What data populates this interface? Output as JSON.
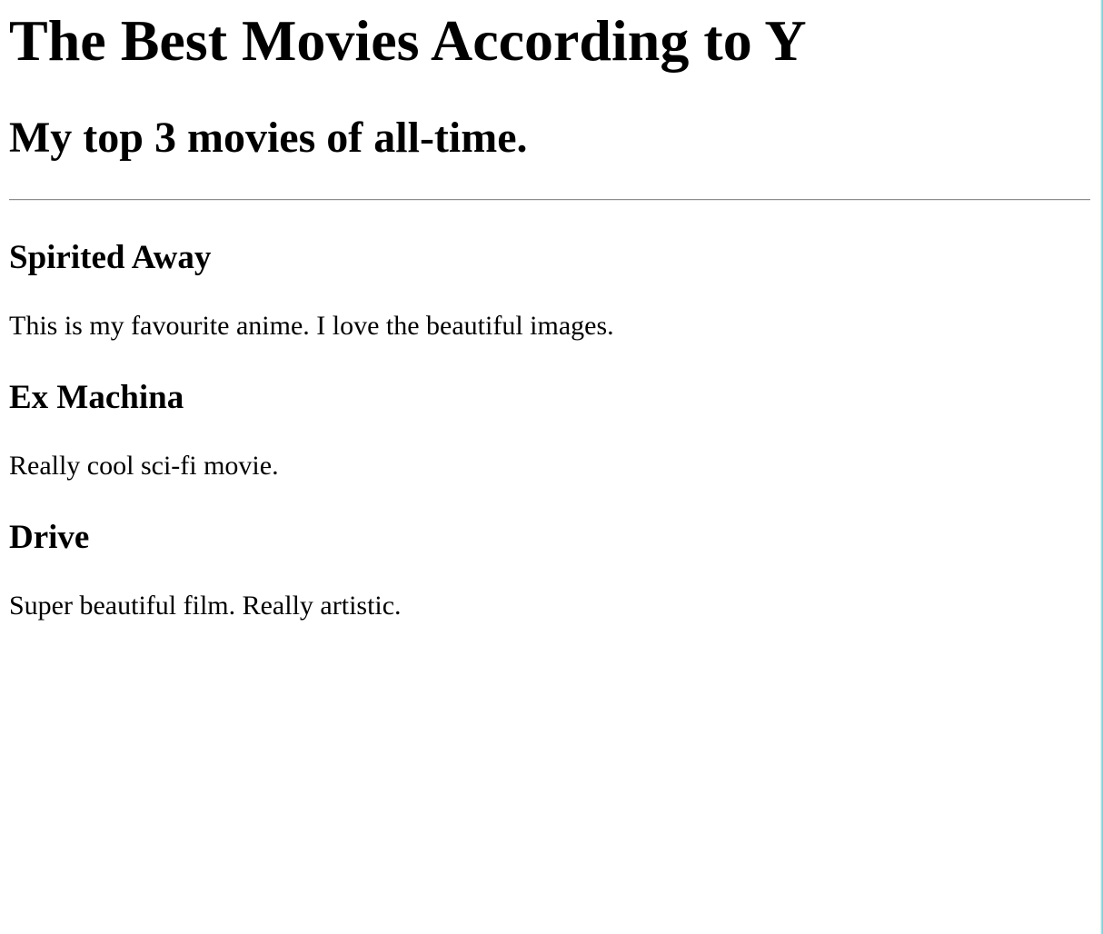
{
  "page": {
    "title": "The Best Movies According to Y",
    "subtitle": "My top 3 movies of all-time."
  },
  "movies": [
    {
      "title": "Spirited Away",
      "description": "This is my favourite anime. I love the beautiful images."
    },
    {
      "title": "Ex Machina",
      "description": "Really cool sci-fi movie."
    },
    {
      "title": "Drive",
      "description": "Super beautiful film. Really artistic."
    }
  ],
  "colors": {
    "text": "#000000",
    "background": "#ffffff",
    "divider": "#8e8e8e",
    "edge_accent": "#7cc8d0"
  }
}
